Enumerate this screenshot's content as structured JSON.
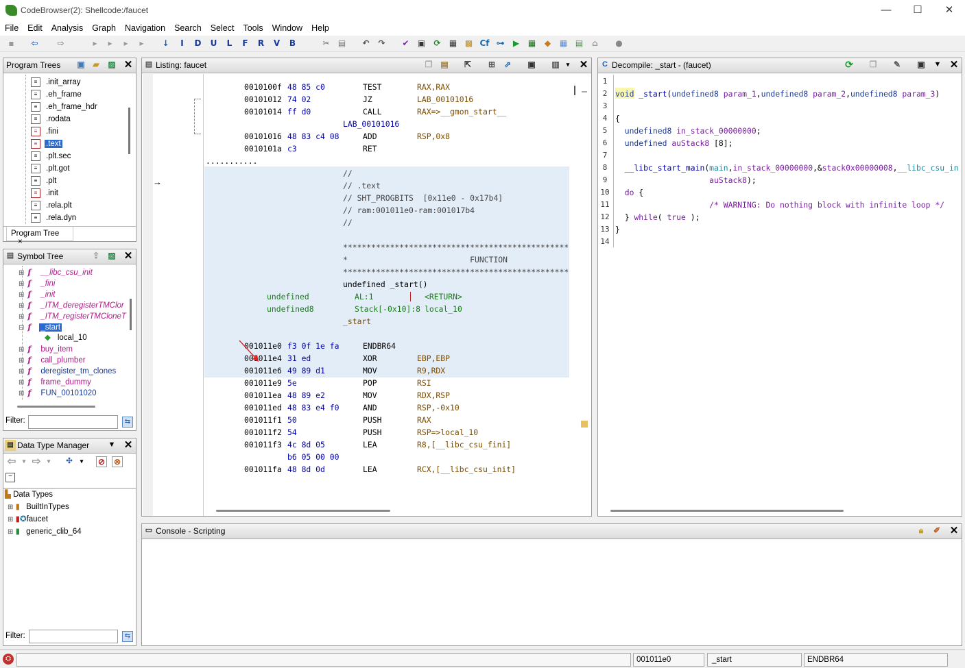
{
  "window": {
    "title": "CodeBrowser(2): Shellcode:/faucet",
    "minimize": "—",
    "maximize": "☐",
    "close": "✕"
  },
  "menu": [
    "File",
    "Edit",
    "Analysis",
    "Graph",
    "Navigation",
    "Search",
    "Select",
    "Tools",
    "Window",
    "Help"
  ],
  "toolbar_letters": [
    "I",
    "D",
    "U",
    "L",
    "F",
    "R",
    "V",
    "B"
  ],
  "program_trees": {
    "title": "Program Trees",
    "tab": "Program Tree",
    "tab_close": "×",
    "items": [
      ".init_array",
      ".eh_frame",
      ".eh_frame_hdr",
      ".rodata",
      ".fini",
      ".text",
      ".plt.sec",
      ".plt.got",
      ".plt",
      ".init",
      ".rela.plt",
      ".rela.dyn"
    ],
    "selected": ".text"
  },
  "symbol_tree": {
    "title": "Symbol Tree",
    "items": [
      "__libc_csu_init",
      "_fini",
      "_init",
      "_ITM_deregisterTMClor",
      "_ITM_registerTMCloneT",
      "_start",
      "local_10",
      "buy_item",
      "call_plumber",
      "deregister_tm_clones",
      "frame_dummy",
      "FUN_00101020"
    ],
    "selected": "_start",
    "filter_label": "Filter:"
  },
  "data_type_manager": {
    "title": "Data Type Manager",
    "root": "Data Types",
    "items": [
      "BuiltInTypes",
      "faucet",
      "generic_clib_64"
    ],
    "filter_label": "Filter:"
  },
  "listing": {
    "title": "Listing:  faucet",
    "lines": [
      {
        "a": "0010100f",
        "b": "48 85 c0",
        "m": "TEST",
        "o": "RAX,RAX"
      },
      {
        "a": "00101012",
        "b": "74 02",
        "m": "JZ",
        "o": "LAB_00101016"
      },
      {
        "a": "00101014",
        "b": "ff d0",
        "m": "CALL",
        "o": "RAX=>__gmon_start__"
      },
      {
        "label": "LAB_00101016"
      },
      {
        "a": "00101016",
        "b": "48 83 c4 08",
        "m": "ADD",
        "o": "RSP,0x8"
      },
      {
        "a": "0010101a",
        "b": "c3",
        "m": "RET",
        "o": ""
      }
    ],
    "dots": "...........",
    "section_comment": [
      "//",
      "// .text",
      "// SHT_PROGBITS  [0x11e0 - 0x17b4]",
      "// ram:001011e0-ram:001017b4",
      "//"
    ],
    "stars": "*********************************************************",
    "function_banner": "*                          FUNCTION",
    "signature": "undefined _start()",
    "params": [
      {
        "type": "undefined",
        "loc": "AL:1",
        "name": "<RETURN>"
      },
      {
        "type": "undefined8",
        "loc": "Stack[-0x10]:8",
        "name": "local_10"
      }
    ],
    "func_label": "_start",
    "code": [
      {
        "a": "001011e0",
        "b": "f3 0f 1e fa",
        "m": "ENDBR64",
        "o": ""
      },
      {
        "a": "001011e4",
        "b": "31 ed",
        "m": "XOR",
        "o": "EBP,EBP"
      },
      {
        "a": "001011e6",
        "b": "49 89 d1",
        "m": "MOV",
        "o": "R9,RDX"
      },
      {
        "a": "001011e9",
        "b": "5e",
        "m": "POP",
        "o": "RSI"
      },
      {
        "a": "001011ea",
        "b": "48 89 e2",
        "m": "MOV",
        "o": "RDX,RSP"
      },
      {
        "a": "001011ed",
        "b": "48 83 e4 f0",
        "m": "AND",
        "o": "RSP,-0x10"
      },
      {
        "a": "001011f1",
        "b": "50",
        "m": "PUSH",
        "o": "RAX"
      },
      {
        "a": "001011f2",
        "b": "54",
        "m": "PUSH",
        "o": "RSP=>local_10"
      },
      {
        "a": "001011f3",
        "b": "4c 8d 05",
        "m": "LEA",
        "o": "R8,[__libc_csu_fini]"
      },
      {
        "a": "",
        "b": "b6 05 00 00",
        "m": "",
        "o": ""
      },
      {
        "a": "001011fa",
        "b": "48 8d 0d",
        "m": "LEA",
        "o": "RCX,[__libc_csu_init]"
      }
    ]
  },
  "decompile": {
    "title": "Decompile: _start -  (faucet)",
    "line_numbers": [
      "1",
      "2",
      "3",
      "4",
      "5",
      "6",
      "7",
      "8",
      "9",
      "10",
      "11",
      "12",
      "13",
      "14"
    ],
    "code": [
      "",
      "void _start(undefined8 param_1,undefined8 param_2,undefined8 param_3)",
      "",
      "{",
      "  undefined8 in_stack_00000000;",
      "  undefined auStack8 [8];",
      "",
      "  __libc_start_main(main,in_stack_00000000,&stack0x00000008,__libc_csu_in",
      "                    auStack8);",
      "  do {",
      "                    /* WARNING: Do nothing block with infinite loop */",
      "  } while( true );",
      "}",
      ""
    ]
  },
  "console": {
    "title": "Console - Scripting"
  },
  "status": {
    "address": "001011e0",
    "function": "_start",
    "instruction": "ENDBR64"
  }
}
